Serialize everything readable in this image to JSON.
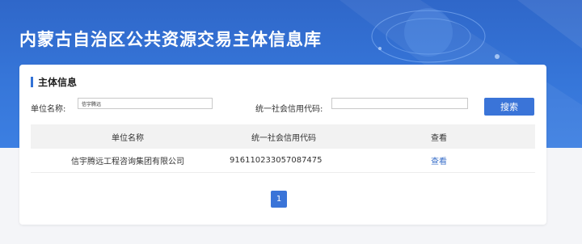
{
  "site": {
    "title": "内蒙古自治区公共资源交易主体信息库"
  },
  "section": {
    "title": "主体信息"
  },
  "search": {
    "name_label": "单位名称:",
    "name_value": "信宇腾远",
    "code_label": "统一社会信用代码:",
    "code_value": "",
    "button_label": "搜索"
  },
  "table": {
    "headers": [
      "单位名称",
      "统一社会信用代码",
      "查看"
    ],
    "rows": [
      {
        "name": "信宇腾远工程咨询集团有限公司",
        "code": "916110233057087475",
        "view": "查看"
      }
    ]
  },
  "pagination": {
    "current": "1"
  },
  "colors": {
    "primary": "#3a74d8",
    "banner": "#3676d9",
    "link": "#3a6fc9"
  }
}
